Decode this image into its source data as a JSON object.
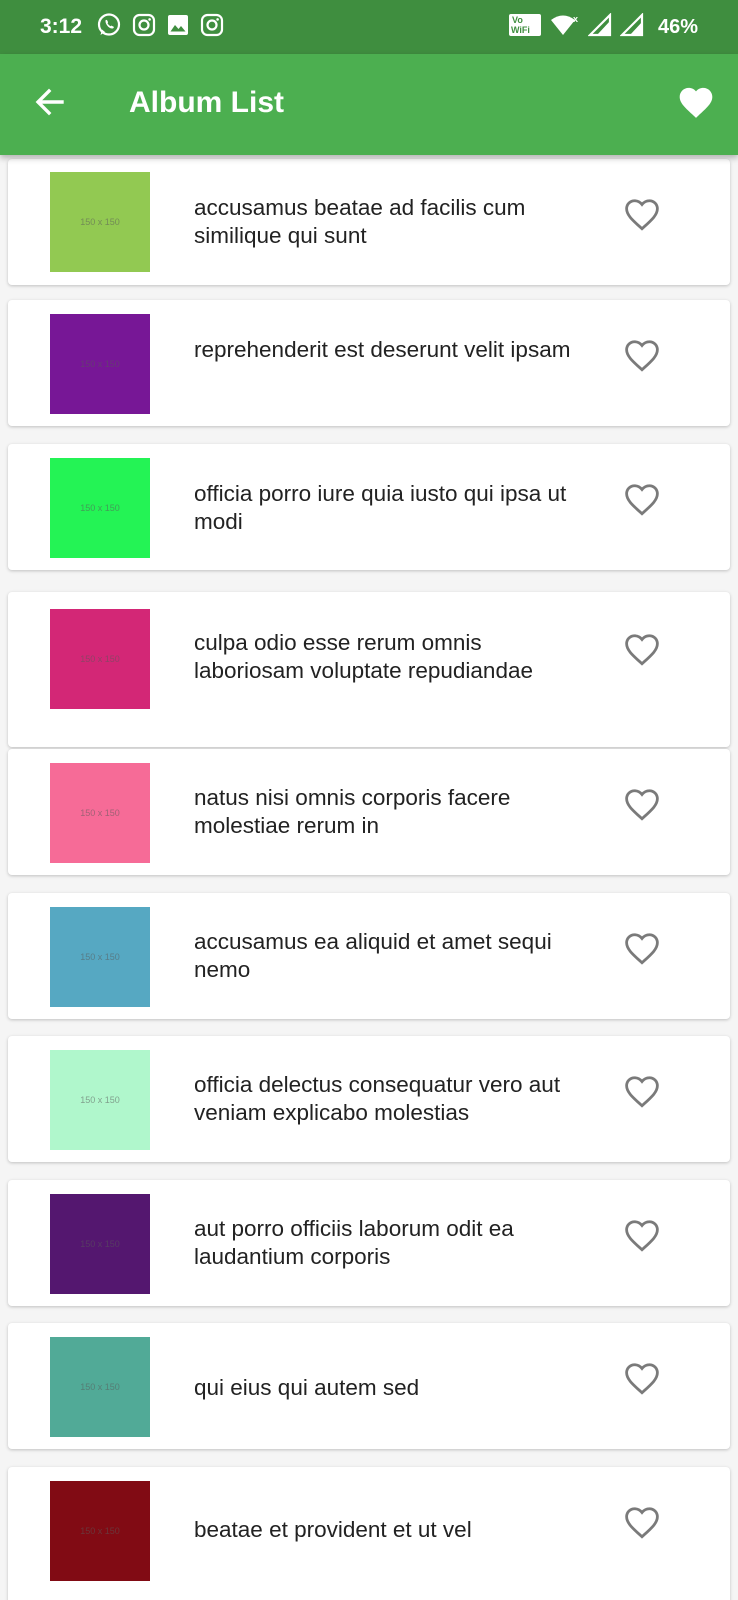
{
  "status_bar": {
    "time": "3:12",
    "battery": "46%",
    "left_icons": [
      "whatsapp-icon",
      "instagram-icon",
      "gallery-icon",
      "instagram-icon"
    ],
    "right_icons": [
      "vowifi-icon",
      "wifi-icon",
      "signal-icon",
      "signal-icon"
    ]
  },
  "app_bar": {
    "title": "Album List",
    "back_icon": "arrow-back-icon",
    "action_icon": "heart-filled-icon",
    "color": "#4caf50"
  },
  "albums": [
    {
      "title": "accusamus beatae ad facilis cum similique qui sunt",
      "thumb_color": "#92c952",
      "thumb_label": "150 x 150",
      "favorite": false
    },
    {
      "title": "reprehenderit est deserunt velit ipsam",
      "thumb_color": "#771796",
      "thumb_label": "150 x 150",
      "favorite": false
    },
    {
      "title": "officia porro iure quia iusto qui ipsa ut modi",
      "thumb_color": "#24f355",
      "thumb_label": "150 x 150",
      "favorite": false
    },
    {
      "title": "culpa odio esse rerum omnis laboriosam voluptate repudiandae",
      "thumb_color": "#d32776",
      "thumb_label": "150 x 150",
      "favorite": false
    },
    {
      "title": "natus nisi omnis corporis facere molestiae rerum in",
      "thumb_color": "#f66b97",
      "thumb_label": "150 x 150",
      "favorite": false
    },
    {
      "title": "accusamus ea aliquid et amet sequi nemo",
      "thumb_color": "#56a8c2",
      "thumb_label": "150 x 150",
      "favorite": false
    },
    {
      "title": "officia delectus consequatur vero aut veniam explicabo molestias",
      "thumb_color": "#b0f7cc",
      "thumb_label": "150 x 150",
      "favorite": false
    },
    {
      "title": "aut porro officiis laborum odit ea laudantium corporis",
      "thumb_color": "#54176f",
      "thumb_label": "150 x 150",
      "favorite": false
    },
    {
      "title": "qui eius qui autem sed",
      "thumb_color": "#51aa97",
      "thumb_label": "150 x 150",
      "favorite": false
    },
    {
      "title": "beatae et provident et ut vel",
      "thumb_color": "#810b14",
      "thumb_label": "150 x 150",
      "favorite": false
    }
  ]
}
